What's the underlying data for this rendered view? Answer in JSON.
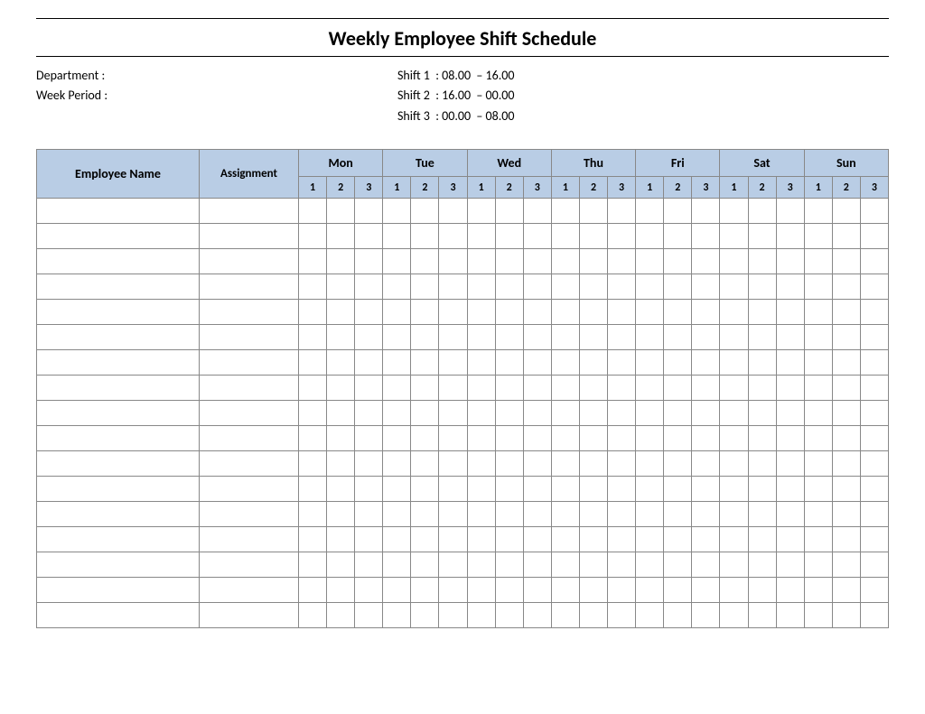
{
  "title": "Weekly Employee Shift Schedule",
  "meta": {
    "department_label": "Department    :",
    "department_value": "",
    "week_period_label": "Week  Period :",
    "week_period_value": ""
  },
  "shifts": {
    "shift1": "Shift 1  : 08.00  – 16.00",
    "shift2": "Shift 2  : 16.00  – 00.00",
    "shift3": "Shift 3  : 00.00  – 08.00"
  },
  "headers": {
    "employee_name": "Employee Name",
    "assignment": "Assignment",
    "days": [
      "Mon",
      "Tue",
      "Wed",
      "Thu",
      "Fri",
      "Sat",
      "Sun"
    ],
    "shift_nums": [
      "1",
      "2",
      "3"
    ]
  },
  "rows": [
    {
      "name": "",
      "assignment": "",
      "cells": [
        "",
        "",
        "",
        "",
        "",
        "",
        "",
        "",
        "",
        "",
        "",
        "",
        "",
        "",
        "",
        "",
        "",
        "",
        "",
        "",
        ""
      ]
    },
    {
      "name": "",
      "assignment": "",
      "cells": [
        "",
        "",
        "",
        "",
        "",
        "",
        "",
        "",
        "",
        "",
        "",
        "",
        "",
        "",
        "",
        "",
        "",
        "",
        "",
        "",
        ""
      ]
    },
    {
      "name": "",
      "assignment": "",
      "cells": [
        "",
        "",
        "",
        "",
        "",
        "",
        "",
        "",
        "",
        "",
        "",
        "",
        "",
        "",
        "",
        "",
        "",
        "",
        "",
        "",
        ""
      ]
    },
    {
      "name": "",
      "assignment": "",
      "cells": [
        "",
        "",
        "",
        "",
        "",
        "",
        "",
        "",
        "",
        "",
        "",
        "",
        "",
        "",
        "",
        "",
        "",
        "",
        "",
        "",
        ""
      ]
    },
    {
      "name": "",
      "assignment": "",
      "cells": [
        "",
        "",
        "",
        "",
        "",
        "",
        "",
        "",
        "",
        "",
        "",
        "",
        "",
        "",
        "",
        "",
        "",
        "",
        "",
        "",
        ""
      ]
    },
    {
      "name": "",
      "assignment": "",
      "cells": [
        "",
        "",
        "",
        "",
        "",
        "",
        "",
        "",
        "",
        "",
        "",
        "",
        "",
        "",
        "",
        "",
        "",
        "",
        "",
        "",
        ""
      ]
    },
    {
      "name": "",
      "assignment": "",
      "cells": [
        "",
        "",
        "",
        "",
        "",
        "",
        "",
        "",
        "",
        "",
        "",
        "",
        "",
        "",
        "",
        "",
        "",
        "",
        "",
        "",
        ""
      ]
    },
    {
      "name": "",
      "assignment": "",
      "cells": [
        "",
        "",
        "",
        "",
        "",
        "",
        "",
        "",
        "",
        "",
        "",
        "",
        "",
        "",
        "",
        "",
        "",
        "",
        "",
        "",
        ""
      ]
    },
    {
      "name": "",
      "assignment": "",
      "cells": [
        "",
        "",
        "",
        "",
        "",
        "",
        "",
        "",
        "",
        "",
        "",
        "",
        "",
        "",
        "",
        "",
        "",
        "",
        "",
        "",
        ""
      ]
    },
    {
      "name": "",
      "assignment": "",
      "cells": [
        "",
        "",
        "",
        "",
        "",
        "",
        "",
        "",
        "",
        "",
        "",
        "",
        "",
        "",
        "",
        "",
        "",
        "",
        "",
        "",
        ""
      ]
    },
    {
      "name": "",
      "assignment": "",
      "cells": [
        "",
        "",
        "",
        "",
        "",
        "",
        "",
        "",
        "",
        "",
        "",
        "",
        "",
        "",
        "",
        "",
        "",
        "",
        "",
        "",
        ""
      ]
    },
    {
      "name": "",
      "assignment": "",
      "cells": [
        "",
        "",
        "",
        "",
        "",
        "",
        "",
        "",
        "",
        "",
        "",
        "",
        "",
        "",
        "",
        "",
        "",
        "",
        "",
        "",
        ""
      ]
    },
    {
      "name": "",
      "assignment": "",
      "cells": [
        "",
        "",
        "",
        "",
        "",
        "",
        "",
        "",
        "",
        "",
        "",
        "",
        "",
        "",
        "",
        "",
        "",
        "",
        "",
        "",
        ""
      ]
    },
    {
      "name": "",
      "assignment": "",
      "cells": [
        "",
        "",
        "",
        "",
        "",
        "",
        "",
        "",
        "",
        "",
        "",
        "",
        "",
        "",
        "",
        "",
        "",
        "",
        "",
        "",
        ""
      ]
    },
    {
      "name": "",
      "assignment": "",
      "cells": [
        "",
        "",
        "",
        "",
        "",
        "",
        "",
        "",
        "",
        "",
        "",
        "",
        "",
        "",
        "",
        "",
        "",
        "",
        "",
        "",
        ""
      ]
    },
    {
      "name": "",
      "assignment": "",
      "cells": [
        "",
        "",
        "",
        "",
        "",
        "",
        "",
        "",
        "",
        "",
        "",
        "",
        "",
        "",
        "",
        "",
        "",
        "",
        "",
        "",
        ""
      ]
    },
    {
      "name": "",
      "assignment": "",
      "cells": [
        "",
        "",
        "",
        "",
        "",
        "",
        "",
        "",
        "",
        "",
        "",
        "",
        "",
        "",
        "",
        "",
        "",
        "",
        "",
        "",
        ""
      ]
    }
  ]
}
